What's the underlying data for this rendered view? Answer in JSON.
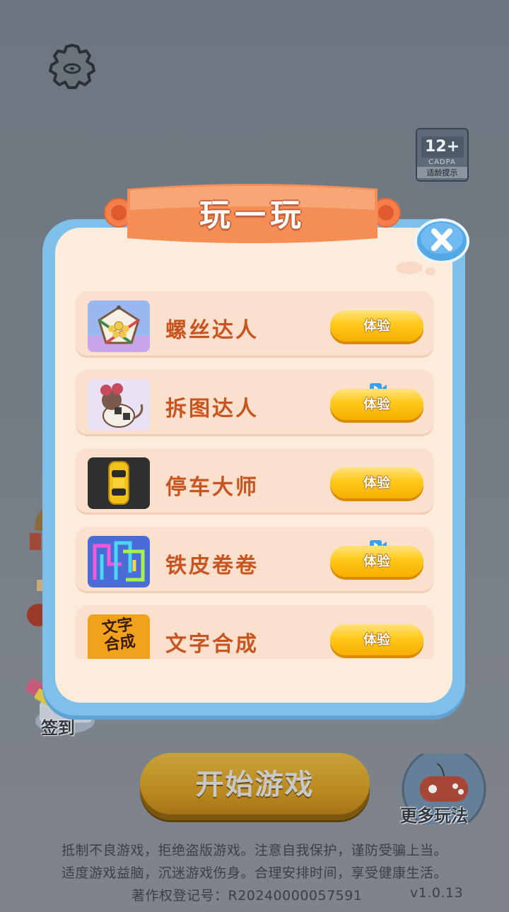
{
  "age_rating": {
    "value": "12+",
    "org": "CADPA",
    "tip": "适龄提示"
  },
  "signin_label": "签到",
  "start_button": "开始游戏",
  "more_games_label": "更多玩法",
  "footer": {
    "line1": "抵制不良游戏，拒绝盗版游戏。注意自我保护，谨防受骗上当。",
    "line2": "适度游戏益脑，沉迷游戏伤身。合理安排时间，享受健康生活。",
    "copyright": "著作权登记号：R20240000057591",
    "version": "v1.0.13"
  },
  "modal": {
    "title": "玩一玩",
    "games": [
      {
        "name": "螺丝达人",
        "button": "体验",
        "icon": "screw-puzzle-icon",
        "video": false
      },
      {
        "name": "拆图达人",
        "button": "体验",
        "icon": "robot-mouse-icon",
        "video": true
      },
      {
        "name": "停车大师",
        "button": "体验",
        "icon": "yellow-car-icon",
        "video": false
      },
      {
        "name": "铁皮卷卷",
        "button": "体验",
        "icon": "neon-pipes-icon",
        "video": true
      },
      {
        "name": "文字合成",
        "button": "体验",
        "icon": "word-merge-icon",
        "video": false
      }
    ],
    "word_icon_text": "文字合成"
  }
}
